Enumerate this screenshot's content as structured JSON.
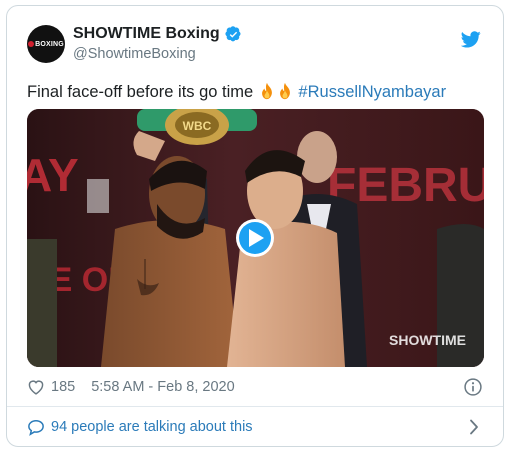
{
  "account": {
    "display_name": "SHOWTIME Boxing",
    "handle": "@ShowtimeBoxing",
    "avatar_text": "BOXING",
    "verified": true
  },
  "tweet": {
    "text": "Final face-off before its go time",
    "emoji": "🔥🔥",
    "hashtag": "#RussellNyambayar"
  },
  "media": {
    "type": "video",
    "background_words": [
      "AY",
      "FEBRU",
      "VE ON",
      "SHOWTIME"
    ],
    "belt_text": "WBC",
    "watermark": "SHOWTIME"
  },
  "meta": {
    "likes": "185",
    "timestamp": "5:58 AM - Feb 8, 2020"
  },
  "footer": {
    "talking": "94 people are talking about this"
  },
  "colors": {
    "link": "#2b7bb9",
    "twitter_blue": "#1da1f2",
    "muted": "#697882"
  },
  "icons": [
    "verified-badge-icon",
    "twitter-bird-icon",
    "fire-icon",
    "play-icon",
    "heart-icon",
    "info-icon",
    "speech-bubble-icon",
    "chevron-right-icon"
  ]
}
